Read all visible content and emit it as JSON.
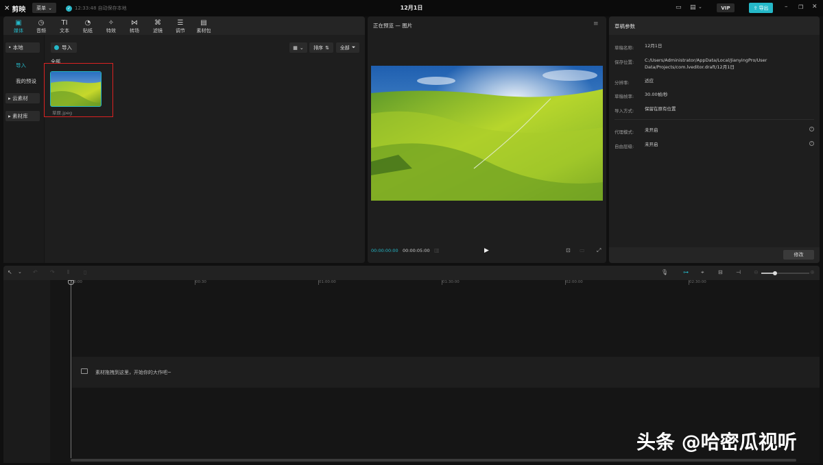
{
  "app": {
    "logo_text": "剪映",
    "menu_label": "菜单",
    "save_status": "12:33:48 自动保存本地",
    "window_title": "12月1日",
    "vip_label": "VIP",
    "export_label": "导出"
  },
  "toolbar": {
    "items": [
      {
        "label": "媒体",
        "icon": "media-icon",
        "glyph": "▣"
      },
      {
        "label": "音频",
        "icon": "audio-icon",
        "glyph": "◷"
      },
      {
        "label": "文本",
        "icon": "text-icon",
        "glyph": "TI"
      },
      {
        "label": "贴纸",
        "icon": "sticker-icon",
        "glyph": "◔"
      },
      {
        "label": "特效",
        "icon": "effects-icon",
        "glyph": "✧"
      },
      {
        "label": "转场",
        "icon": "transition-icon",
        "glyph": "⋈"
      },
      {
        "label": "滤镜",
        "icon": "filter-icon",
        "glyph": "⌘"
      },
      {
        "label": "调节",
        "icon": "adjust-icon",
        "glyph": "☰"
      },
      {
        "label": "素材包",
        "icon": "package-icon",
        "glyph": "▤"
      }
    ]
  },
  "sidebar": {
    "local": "• 本地",
    "import": "导入",
    "my_presets": "我的预设",
    "cloud": "▸ 云素材",
    "library": "▸ 素材库"
  },
  "media": {
    "import_label": "导入",
    "sort_label": "排序",
    "filter_label": "全部",
    "all_label": "全部",
    "thumbnail_name": "草原.jpeg"
  },
  "preview": {
    "title": "正在预览 — 图片",
    "timecode_current": "00:00:00:00",
    "timecode_total": "00:00:05:00"
  },
  "draft": {
    "header": "草稿参数",
    "rows": [
      {
        "label": "草稿名称:",
        "value": "12月1日"
      },
      {
        "label": "保存位置:",
        "value": "C:/Users/Administrator/AppData/Local/JianyingPro/User Data/Projects/com.lveditor.draft/12月1日"
      },
      {
        "label": "分辨率:",
        "value": "适应"
      },
      {
        "label": "草稿帧率:",
        "value": "30.00帧/秒"
      },
      {
        "label": "导入方式:",
        "value": "保留在原有位置"
      },
      {
        "label": "代理模式:",
        "value": "未开启"
      },
      {
        "label": "自由层级:",
        "value": "未开启"
      }
    ],
    "modify_label": "修改"
  },
  "timeline": {
    "ticks": [
      "00:00",
      "00:30",
      "01:00:00",
      "01:30:00",
      "02:00:00",
      "02:30:00"
    ],
    "drop_text": "素材拖拽到这里，开始你的大作吧~"
  },
  "watermark": "头条 @哈密瓜视听"
}
